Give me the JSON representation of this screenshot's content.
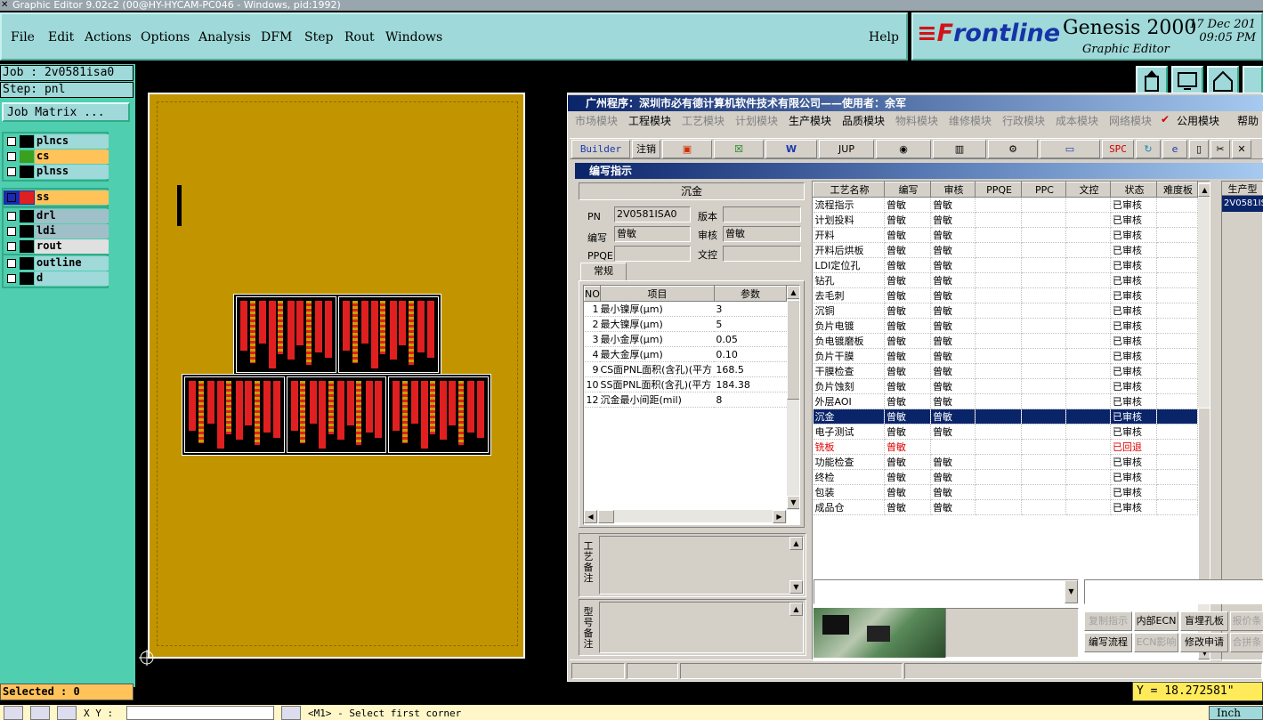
{
  "window": {
    "title": "Graphic Editor 9.02c2 (00@HY-HYCAM-PC046 - Windows, pid:1992)"
  },
  "menu": {
    "file": "File",
    "edit": "Edit",
    "actions": "Actions",
    "options": "Options",
    "analysis": "Analysis",
    "dfm": "DFM",
    "step": "Step",
    "rout": "Rout",
    "windows": "Windows",
    "help": "Help"
  },
  "brand": {
    "logo_red": "≡F",
    "logo_blue": "rontline",
    "product": "Genesis 2000",
    "subtitle": "Graphic Editor",
    "date": "17 Dec 201",
    "time": "09:05 PM"
  },
  "job": {
    "job_line": "Job : 2v0581isa0",
    "step_line": "Step: pnl",
    "matrix_button": "Job Matrix ..."
  },
  "layers": [
    {
      "name": "plncs",
      "color": "#000000",
      "bg": "#9fd9d9",
      "active": false
    },
    {
      "name": "cs",
      "color": "#3aa020",
      "bg": "#ffc35a",
      "active": false
    },
    {
      "name": "plnss",
      "color": "#000000",
      "bg": "#9fd9d9",
      "active": false
    },
    {
      "name": "ss",
      "color": "#e02020",
      "bg": "#ffc35a",
      "active": true
    },
    {
      "name": "drl",
      "color": "#000000",
      "bg": "#9fc0c8",
      "active": false
    },
    {
      "name": "ldi",
      "color": "#000000",
      "bg": "#9fc0c8",
      "active": false
    },
    {
      "name": "rout",
      "color": "#000000",
      "bg": "#e0e0e0",
      "active": false
    },
    {
      "name": "outline",
      "color": "#000000",
      "bg": "#9fd9d9",
      "active": false
    },
    {
      "name": "d",
      "color": "#000000",
      "bg": "#9fd9d9",
      "active": false
    }
  ],
  "status": {
    "selected": "Selected : 0",
    "y_coord": "Y = 18.272581\"",
    "xy_label": "X Y :",
    "prompt": "<M1> - Select first corner",
    "units": "Inch"
  },
  "dialog": {
    "title": "广州程序：深圳市必有德计算机软件技术有限公司——使用者：余军",
    "modules": [
      {
        "label": "市场模块",
        "on": false
      },
      {
        "label": "工程模块",
        "on": true
      },
      {
        "label": "工艺模块",
        "on": false
      },
      {
        "label": "计划模块",
        "on": false
      },
      {
        "label": "生产模块",
        "on": true
      },
      {
        "label": "品质模块",
        "on": true
      },
      {
        "label": "物料模块",
        "on": false
      },
      {
        "label": "维修模块",
        "on": false
      },
      {
        "label": "行政模块",
        "on": false
      },
      {
        "label": "成本模块",
        "on": false
      },
      {
        "label": "网络模块",
        "on": false
      },
      {
        "label": "公用模块",
        "on": true
      },
      {
        "label": "帮助",
        "on": true
      }
    ],
    "toolbar": {
      "builder": "Builder",
      "logout": "注销",
      "jup": "JUP",
      "spc": "SPC"
    },
    "subwindow_title": "编写指示",
    "process_name": "沉金",
    "form": {
      "pn_label": "PN",
      "pn_value": "2V0581ISA0",
      "version_label": "版本",
      "version_value": "",
      "author_label": "编写",
      "author_value": "曾敏",
      "reviewer_label": "审核",
      "reviewer_value": "曾敏",
      "ppqe_label": "PPQE",
      "ppqe_value": "",
      "doc_label": "文控",
      "doc_value": ""
    },
    "tab_general": "常规",
    "param_headers": {
      "no": "NO",
      "item": "项目",
      "value": "参数"
    },
    "params": [
      {
        "no": "1",
        "item": "最小镍厚(μm)",
        "value": "3"
      },
      {
        "no": "2",
        "item": "最大镍厚(μm)",
        "value": "5"
      },
      {
        "no": "3",
        "item": "最小金厚(μm)",
        "value": "0.05"
      },
      {
        "no": "4",
        "item": "最大金厚(μm)",
        "value": "0.10"
      },
      {
        "no": "9",
        "item": "CS面PNL面积(含孔)(平方",
        "value": "168.5"
      },
      {
        "no": "10",
        "item": "SS面PNL面积(含孔)(平方",
        "value": "184.38"
      },
      {
        "no": "12",
        "item": "沉金最小间距(mil)",
        "value": "8"
      }
    ],
    "note_process": "工艺备注",
    "note_model": "型号备注",
    "flow_headers": [
      "工艺名称",
      "编写",
      "审核",
      "PPQE",
      "PPC",
      "文控",
      "状态",
      "难度板"
    ],
    "flow_rows": [
      {
        "name": "流程指示",
        "author": "曾敏",
        "reviewer": "曾敏",
        "status": "已审核",
        "sel": false,
        "red": false
      },
      {
        "name": "计划投料",
        "author": "曾敏",
        "reviewer": "曾敏",
        "status": "已审核",
        "sel": false,
        "red": false
      },
      {
        "name": "开料",
        "author": "曾敏",
        "reviewer": "曾敏",
        "status": "已审核",
        "sel": false,
        "red": false
      },
      {
        "name": "开料后烘板",
        "author": "曾敏",
        "reviewer": "曾敏",
        "status": "已审核",
        "sel": false,
        "red": false
      },
      {
        "name": "LDI定位孔",
        "author": "曾敏",
        "reviewer": "曾敏",
        "status": "已审核",
        "sel": false,
        "red": false
      },
      {
        "name": "钻孔",
        "author": "曾敏",
        "reviewer": "曾敏",
        "status": "已审核",
        "sel": false,
        "red": false
      },
      {
        "name": "去毛刺",
        "author": "曾敏",
        "reviewer": "曾敏",
        "status": "已审核",
        "sel": false,
        "red": false
      },
      {
        "name": "沉铜",
        "author": "曾敏",
        "reviewer": "曾敏",
        "status": "已审核",
        "sel": false,
        "red": false
      },
      {
        "name": "负片电镀",
        "author": "曾敏",
        "reviewer": "曾敏",
        "status": "已审核",
        "sel": false,
        "red": false
      },
      {
        "name": "负电镀磨板",
        "author": "曾敏",
        "reviewer": "曾敏",
        "status": "已审核",
        "sel": false,
        "red": false
      },
      {
        "name": "负片干膜",
        "author": "曾敏",
        "reviewer": "曾敏",
        "status": "已审核",
        "sel": false,
        "red": false
      },
      {
        "name": "干膜检查",
        "author": "曾敏",
        "reviewer": "曾敏",
        "status": "已审核",
        "sel": false,
        "red": false
      },
      {
        "name": "负片蚀刻",
        "author": "曾敏",
        "reviewer": "曾敏",
        "status": "已审核",
        "sel": false,
        "red": false
      },
      {
        "name": "外层AOI",
        "author": "曾敏",
        "reviewer": "曾敏",
        "status": "已审核",
        "sel": false,
        "red": false
      },
      {
        "name": "沉金",
        "author": "曾敏",
        "reviewer": "曾敏",
        "status": "已审核",
        "sel": true,
        "red": false
      },
      {
        "name": "电子测试",
        "author": "曾敏",
        "reviewer": "曾敏",
        "status": "已审核",
        "sel": false,
        "red": false
      },
      {
        "name": "铣板",
        "author": "曾敏",
        "reviewer": "",
        "status": "已回退",
        "sel": false,
        "red": true
      },
      {
        "name": "功能检查",
        "author": "曾敏",
        "reviewer": "曾敏",
        "status": "已审核",
        "sel": false,
        "red": false
      },
      {
        "name": "终检",
        "author": "曾敏",
        "reviewer": "曾敏",
        "status": "已审核",
        "sel": false,
        "red": false
      },
      {
        "name": "包装",
        "author": "曾敏",
        "reviewer": "曾敏",
        "status": "已审核",
        "sel": false,
        "red": false
      },
      {
        "name": "成品仓",
        "author": "曾敏",
        "reviewer": "曾敏",
        "status": "已审核",
        "sel": false,
        "red": false
      }
    ],
    "side_header": "生产型",
    "side_value": "2V0581IS",
    "buttons": {
      "copy": "复制指示",
      "internal_ecn": "内部ECN",
      "buried_hole": "盲埋孔板",
      "quote": "报价条",
      "write_flow": "编写流程",
      "ecn_impact": "ECN影响",
      "modify_request": "修改申请",
      "combine": "合拼条"
    }
  }
}
